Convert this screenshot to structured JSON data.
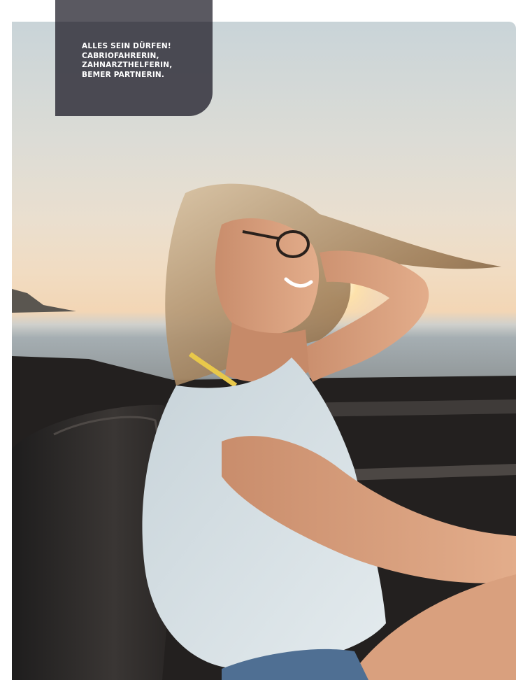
{
  "caption": {
    "lines": [
      "ALLES SEIN DÜRFEN!",
      "CABRIOFAHRERIN,",
      "ZAHNARZTHELFERIN,",
      "BEMER PARTNERIN."
    ]
  },
  "colors": {
    "caption_background": "#44434c",
    "caption_text": "#ffffff"
  }
}
